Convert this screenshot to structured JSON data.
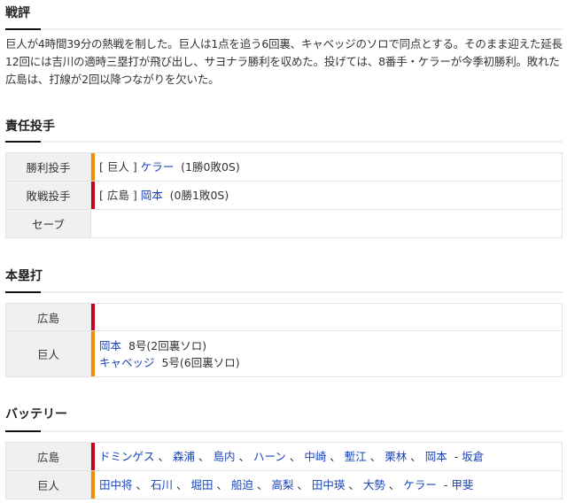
{
  "review": {
    "title": "戦評",
    "text": "巨人が4時間39分の熱戦を制した。巨人は1点を追う6回裏、キャベッジのソロで同点とする。そのまま迎えた延長12回には吉川の適時三塁打が飛び出し、サヨナラ勝利を収めた。投げては、8番手・ケラーが今季初勝利。敗れた広島は、打線が2回以降つながりを欠いた。"
  },
  "pitchers": {
    "title": "責任投手",
    "rows": [
      {
        "label": "勝利投手",
        "team": "[ 巨人 ]",
        "name": "ケラー",
        "record": "(1勝0敗0S)",
        "color": "#f08c00"
      },
      {
        "label": "敗戦投手",
        "team": "[ 広島 ]",
        "name": "岡本",
        "record": "(0勝1敗0S)",
        "color": "#c8001e"
      },
      {
        "label": "セーブ"
      }
    ]
  },
  "homeruns": {
    "title": "本塁打",
    "rows": [
      {
        "team": "広島",
        "color": "#c8001e",
        "items": []
      },
      {
        "team": "巨人",
        "color": "#f08c00",
        "items": [
          {
            "name": "岡本",
            "detail": "8号(2回裏ソロ)"
          },
          {
            "name": "キャベッジ",
            "detail": "5号(6回裏ソロ)"
          }
        ]
      }
    ]
  },
  "battery": {
    "title": "バッテリー",
    "rows": [
      {
        "team": "広島",
        "color": "#c8001e",
        "pitchers": [
          "ドミンゲス",
          "森浦",
          "島内",
          "ハーン",
          "中崎",
          "塹江",
          "栗林",
          "岡本"
        ],
        "catcher": "坂倉"
      },
      {
        "team": "巨人",
        "color": "#f08c00",
        "pitchers": [
          "田中将",
          "石川",
          "堀田",
          "船迫",
          "高梨",
          "田中瑛",
          "大勢",
          "ケラー"
        ],
        "catcher": "甲斐"
      }
    ]
  }
}
